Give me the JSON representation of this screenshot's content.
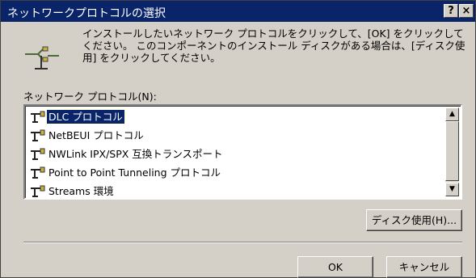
{
  "window": {
    "title": "ネットワークプロトコルの選択",
    "help_label": "?",
    "close_label": "×"
  },
  "info_text": "インストールしたいネットワーク プロトコルをクリックして、[OK] をクリックしてください。 このコンポーネントのインストール ディスクがある場合は、[ディスク使用] をクリックしてください。",
  "list": {
    "label": "ネットワーク プロトコル(N):",
    "items": [
      {
        "label": "DLC プロトコル",
        "selected": true
      },
      {
        "label": "NetBEUI プロトコル",
        "selected": false
      },
      {
        "label": "NWLink IPX/SPX 互換トランスポート",
        "selected": false
      },
      {
        "label": "Point to Point Tunneling プロトコル",
        "selected": false
      },
      {
        "label": "Streams 環境",
        "selected": false
      }
    ],
    "scroll_up": "▲",
    "scroll_down": "▼"
  },
  "buttons": {
    "have_disk": "ディスク使用(H)...",
    "ok": "OK",
    "cancel": "キャンセル"
  },
  "colors": {
    "titlebar": "#0a246a",
    "dialog_face": "#d4d0c8",
    "selection": "#0a246a"
  },
  "icons": {
    "info": "network-protocol-icon",
    "item": "network-protocol-icon"
  }
}
